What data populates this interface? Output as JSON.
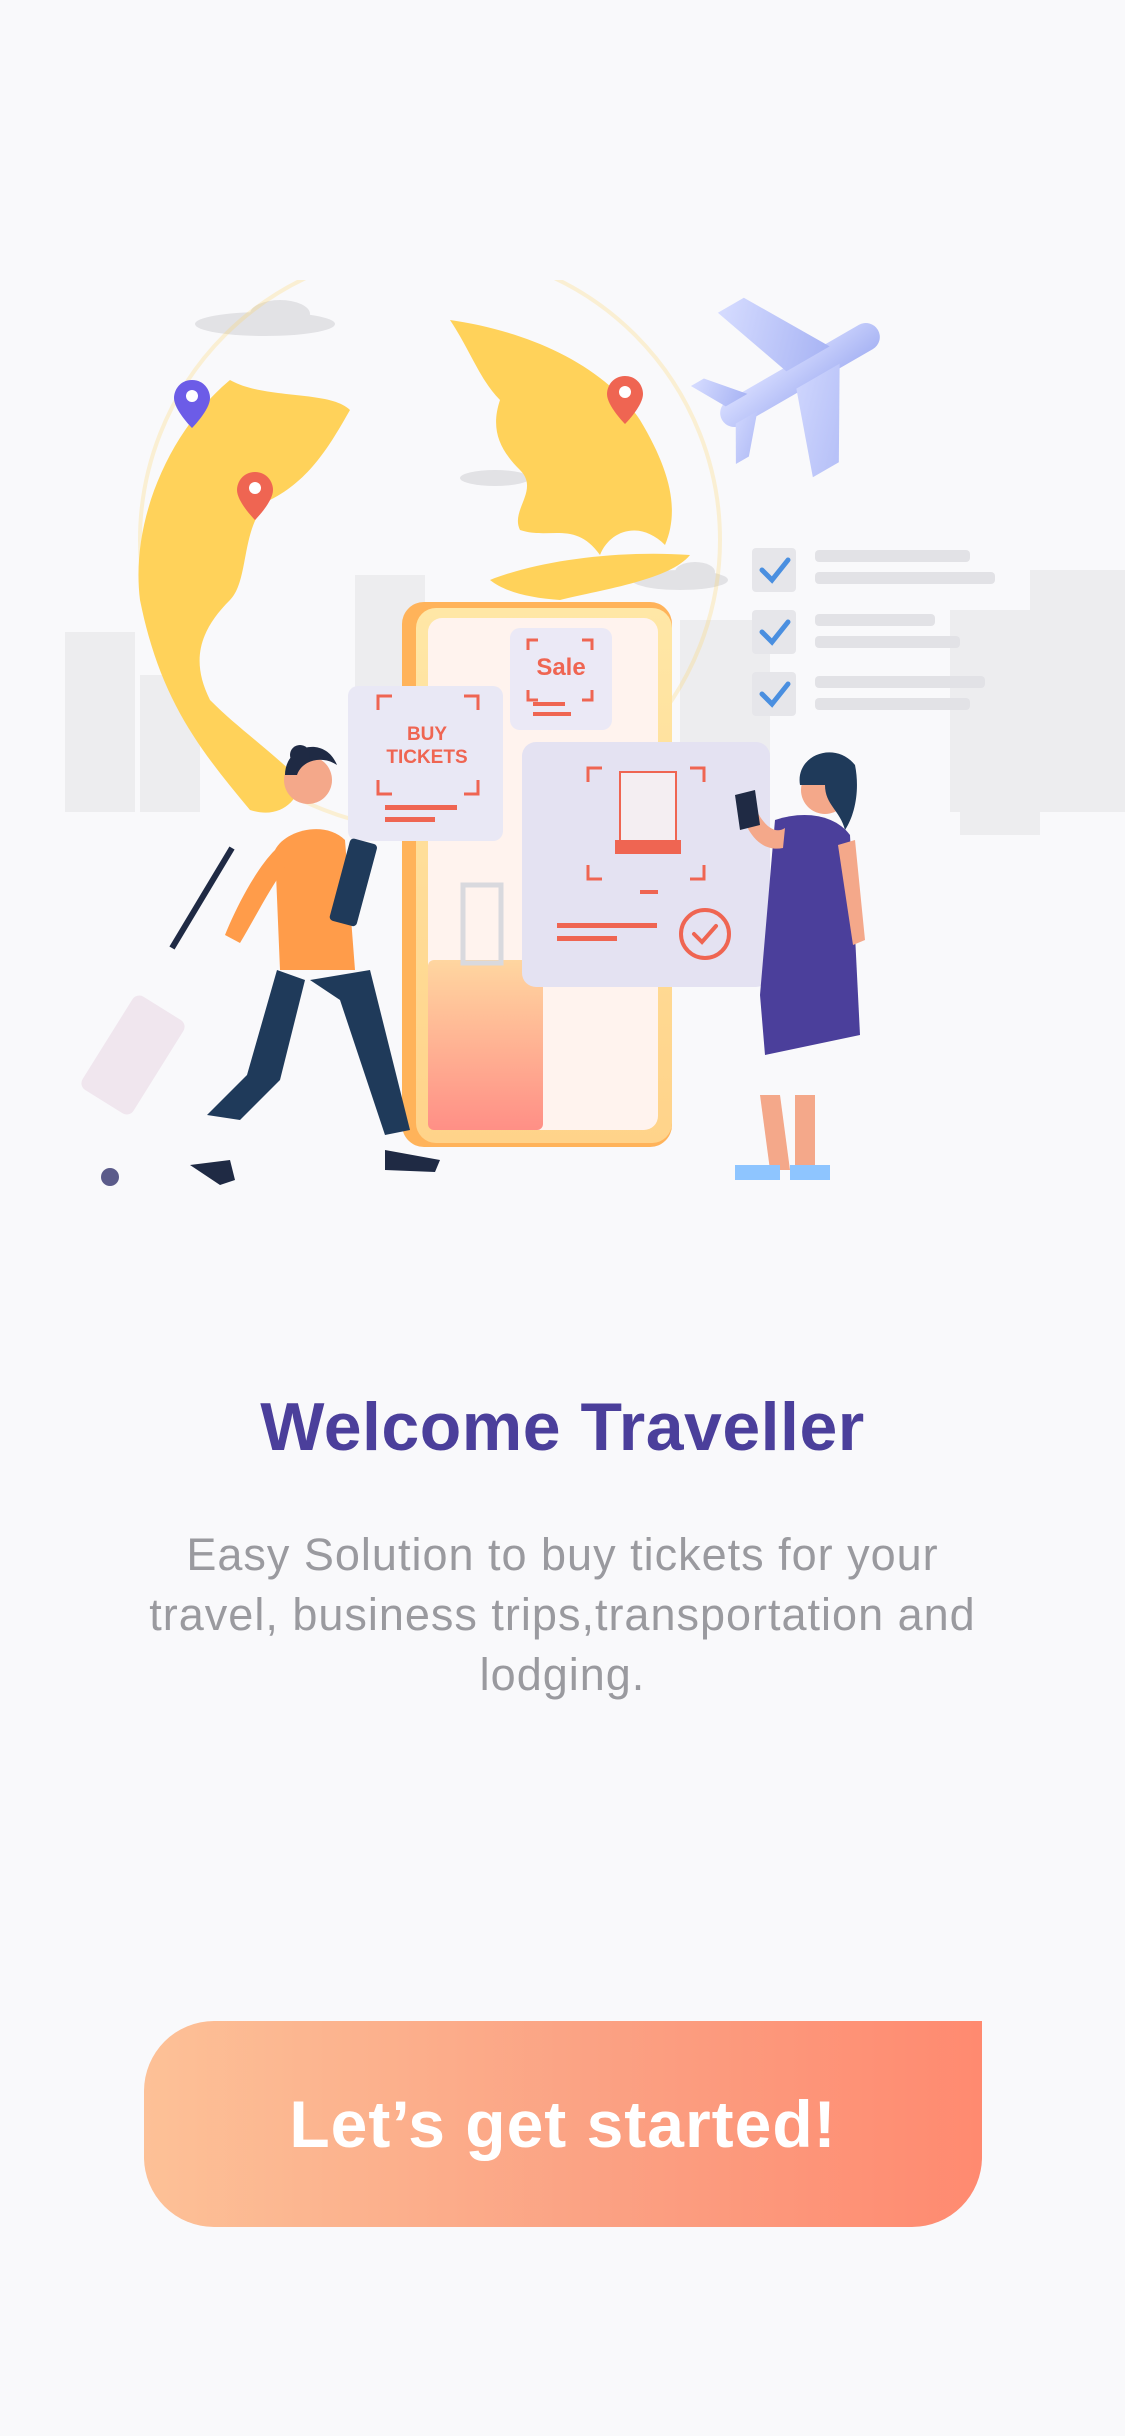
{
  "illustration": {
    "sale_label": "Sale",
    "buy_label_line1": "BUY",
    "buy_label_line2": "TICKETS",
    "accent_colors": {
      "globe": "#ffd25a",
      "purple": "#4b3f9b",
      "orange": "#ff9c4a",
      "coral": "#ef6552",
      "check": "#4a8fe0"
    },
    "icons": [
      "globe-icon",
      "airplane-icon",
      "map-pin-icon",
      "checklist-icon",
      "ticket-icon",
      "luggage-icon",
      "phone-icon",
      "cloud-icon"
    ]
  },
  "welcome": {
    "title": "Welcome Traveller",
    "subtitle": "Easy Solution to buy tickets for your travel, business trips,transportation and lodging."
  },
  "cta": {
    "label": "Let’s get started!",
    "colors": {
      "from": "#fdc197",
      "to": "#ff8a70"
    }
  },
  "theme": {
    "background": "#f9f9fb",
    "title_color": "#4b3f9b",
    "subtitle_color": "#9a9a9f"
  }
}
